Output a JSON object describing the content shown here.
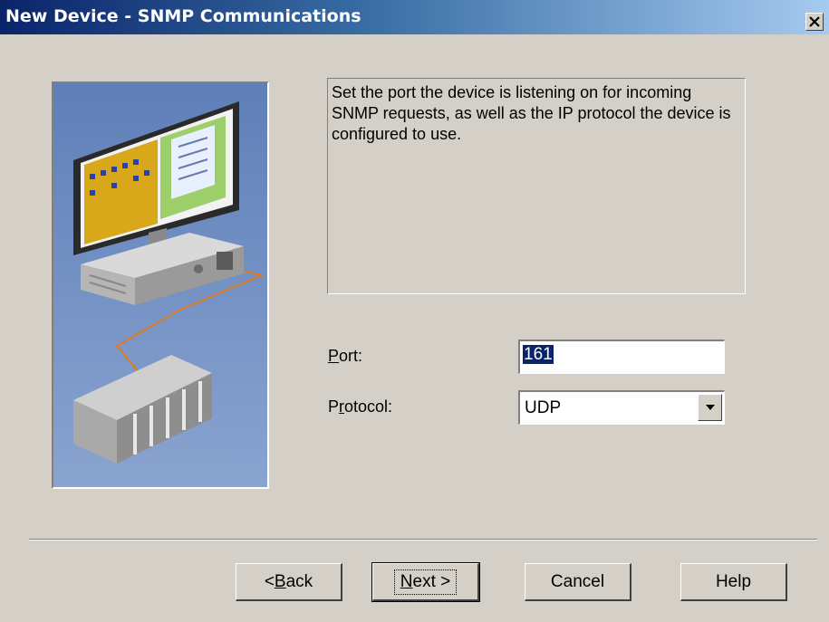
{
  "window": {
    "title": "New Device - SNMP Communications",
    "close_label": "×"
  },
  "description": "Set the port the device is listening on for incoming SNMP requests, as well as the IP protocol the device is configured to use.",
  "port": {
    "label_mnemonic": "P",
    "label_rest": "ort:",
    "value": "161"
  },
  "protocol": {
    "label_start": "P",
    "label_mnemonic": "r",
    "label_rest": "otocol:",
    "value": "UDP"
  },
  "buttons": {
    "back": {
      "prefix": "< ",
      "mnemonic": "B",
      "rest": "ack"
    },
    "next": {
      "mnemonic": "N",
      "rest": "ext >"
    },
    "cancel": "Cancel",
    "help": "Help"
  },
  "icons": {
    "close": "close-icon",
    "dropdown": "chevron-down-icon",
    "wizard": "computer-plc-illustration"
  }
}
